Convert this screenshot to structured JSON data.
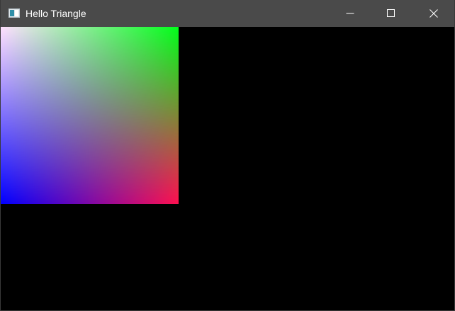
{
  "window": {
    "title": "Hello Triangle"
  },
  "titlebar_buttons": {
    "minimize_icon": "minimize-icon",
    "maximize_icon": "maximize-icon",
    "close_icon": "close-icon"
  },
  "render": {
    "background": "#000000",
    "corner_colors": {
      "top_left": "#ffe0ff",
      "top_right": "#00ff1a",
      "bottom_left": "#0000ff",
      "bottom_right": "#ff1050"
    }
  }
}
